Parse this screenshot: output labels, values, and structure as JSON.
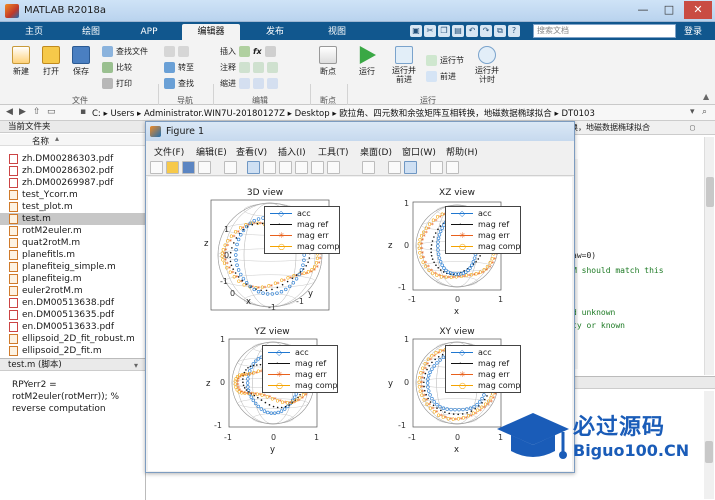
{
  "window": {
    "title": "MATLAB R2018a",
    "controls": [
      "—",
      "□",
      "✕"
    ]
  },
  "tabs": [
    "主页",
    "绘图",
    "APP",
    "编辑器",
    "发布",
    "视图"
  ],
  "active_tab": "编辑器",
  "search": {
    "placeholder": "搜索文档"
  },
  "login_label": "登录",
  "ribbon": {
    "file": {
      "new": "新建",
      "open": "打开",
      "save": "保存",
      "find_file": "查找文件",
      "compare": "比较",
      "print": "打印",
      "label": "文件"
    },
    "nav": {
      "goto": "转至",
      "find": "查找",
      "label": "导航"
    },
    "edit": {
      "insert": "插入",
      "comment": "注释",
      "indent": "缩进",
      "label": "编辑"
    },
    "breakpoint": {
      "breakpoints": "断点",
      "label": "断点"
    },
    "run": {
      "run": "运行",
      "run_advance": "运行并\n前进",
      "run_section": "运行节",
      "advance": "前进",
      "run_time": "运行并\n计时",
      "label": "运行"
    }
  },
  "address": {
    "crumbs": [
      "C:",
      "Users",
      "Administrator.WIN7U-20180127Z",
      "Desktop",
      "欧拉角、四元数和余弦矩阵互相转换，地磁数据椭球拟合",
      "DT0103"
    ]
  },
  "current_folder": {
    "title": "当前文件夹",
    "col": "名称",
    "files": [
      {
        "name": "zh.DM00286303.pdf",
        "type": "pdf"
      },
      {
        "name": "zh.DM00286302.pdf",
        "type": "pdf"
      },
      {
        "name": "zh.DM00269987.pdf",
        "type": "pdf"
      },
      {
        "name": "test_Ycorr.m",
        "type": "m"
      },
      {
        "name": "test_plot.m",
        "type": "m"
      },
      {
        "name": "test.m",
        "type": "m",
        "selected": true
      },
      {
        "name": "rotM2euler.m",
        "type": "m"
      },
      {
        "name": "quat2rotM.m",
        "type": "m"
      },
      {
        "name": "planefitls.m",
        "type": "m"
      },
      {
        "name": "planefiteig_simple.m",
        "type": "m"
      },
      {
        "name": "planefiteig.m",
        "type": "m"
      },
      {
        "name": "euler2rotM.m",
        "type": "m"
      },
      {
        "name": "en.DM00513638.pdf",
        "type": "pdf"
      },
      {
        "name": "en.DM00513635.pdf",
        "type": "pdf"
      },
      {
        "name": "en.DM00513633.pdf",
        "type": "pdf"
      },
      {
        "name": "ellipsoid_2D_fit_robust.m",
        "type": "m"
      },
      {
        "name": "ellipsoid_2D_fit.m",
        "type": "m"
      }
    ]
  },
  "details": {
    "file": "test.m (脚本)",
    "lines": [
      "RPYerr2 =",
      "rotM2euler(rotMerr)); %",
      "reverse computation"
    ]
  },
  "editor": {
    "path_suffix": "换，地磁数据椭球拟合",
    "lines": [
      {
        "n": "",
        "t": ""
      },
      {
        "n": "",
        "t": "aw=0)"
      },
      {
        "n": "",
        "t": "M should match this"
      },
      {
        "n": "",
        "t": ""
      },
      {
        "n": "",
        "t": "d unknown"
      },
      {
        "n": "",
        "t": "ty or known"
      }
    ]
  },
  "figure": {
    "title": "Figure 1",
    "menu": [
      "文件(F)",
      "编辑(E)",
      "查看(V)",
      "插入(I)",
      "工具(T)",
      "桌面(D)",
      "窗口(W)",
      "帮助(H)"
    ]
  },
  "chart_data": [
    {
      "type": "scatter",
      "title": "3D view",
      "xlabel": "x",
      "ylabel": "y",
      "zlabel": "z",
      "xticks": [
        "-1",
        "0",
        "1"
      ],
      "yticks": [
        "-1",
        "0",
        "1"
      ],
      "zticks": [
        "-1",
        "0",
        "1"
      ],
      "series": [
        {
          "name": "acc",
          "color": "#1f77d0",
          "marker": "diamond"
        },
        {
          "name": "mag ref",
          "color": "#111111",
          "marker": "dot"
        },
        {
          "name": "mag err",
          "color": "#e8601c",
          "marker": "asterisk"
        },
        {
          "name": "mag comp",
          "color": "#f4a300",
          "marker": "circle"
        }
      ]
    },
    {
      "type": "scatter",
      "title": "XZ view",
      "xlabel": "x",
      "ylabel": "z",
      "xticks": [
        "-1",
        "0",
        "1"
      ],
      "yticks": [
        "-1",
        "0",
        "1"
      ],
      "series": [
        {
          "name": "acc"
        },
        {
          "name": "mag ref"
        },
        {
          "name": "mag err"
        },
        {
          "name": "mag comp"
        }
      ]
    },
    {
      "type": "scatter",
      "title": "YZ view",
      "xlabel": "y",
      "ylabel": "z",
      "xticks": [
        "-1",
        "0",
        "1"
      ],
      "yticks": [
        "-1",
        "0",
        "1"
      ],
      "series": [
        {
          "name": "acc"
        },
        {
          "name": "mag ref"
        },
        {
          "name": "mag err"
        },
        {
          "name": "mag comp"
        }
      ]
    },
    {
      "type": "scatter",
      "title": "XY view",
      "xlabel": "x",
      "ylabel": "y",
      "xticks": [
        "-1",
        "0",
        "1"
      ],
      "yticks": [
        "-1",
        "0",
        "1"
      ],
      "series": [
        {
          "name": "acc"
        },
        {
          "name": "mag ref"
        },
        {
          "name": "mag err"
        },
        {
          "name": "mag comp"
        }
      ]
    }
  ],
  "watermark": {
    "brand": "必过源码",
    "site": "Biguo100.CN"
  }
}
